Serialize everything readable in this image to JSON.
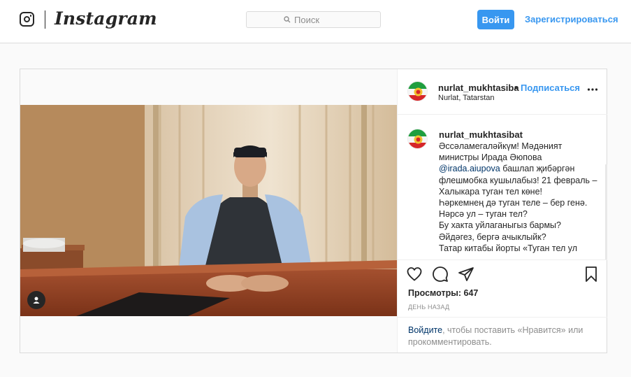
{
  "nav": {
    "brand": "Instagram",
    "search_placeholder": "Поиск",
    "login_label": "Войти",
    "signup_label": "Зарегистрироваться"
  },
  "post": {
    "username": "nurlat_mukhtasiba",
    "separator": "•",
    "follow_label": "Подписаться",
    "location": "Nurlat, Tatarstan",
    "caption_username": "nurlat_mukhtasibat",
    "caption_before_mention": "Әссәламегаләйкүм! Мәдәният министры Ирада Әюпова",
    "mention": "@irada.aiupova",
    "caption_after_mention": " башлап җибәргән флешмобка кушылабыз! 21 февраль – Халыкара туган тел көне!\nҺәркемнең дә туган теле – бер генә.\nНәрсә ул – туган тел?\nБу хакта уйлаганыгыз бармы?\nӘйдәгез, бергә ачыклыйк?\n    Татар китабы йорты «Туган тел ул",
    "views_label": "Просмотры: 647",
    "time_label": "ДЕНЬ НАЗАД",
    "login_prompt_link": "Войдите",
    "login_prompt_text": ", чтобы поставить «Нравится» или прокомментировать.",
    "icons": [
      "instagram-logo-icon",
      "search-icon",
      "more-options-icon",
      "like-heart-icon",
      "comment-icon",
      "share-icon",
      "save-bookmark-icon",
      "tagged-user-icon"
    ],
    "colors": {
      "accent": "#3897f0",
      "link_dark": "#003569",
      "muted": "#8e8e8e",
      "text": "#262626",
      "border": "#dbdbdb"
    }
  }
}
